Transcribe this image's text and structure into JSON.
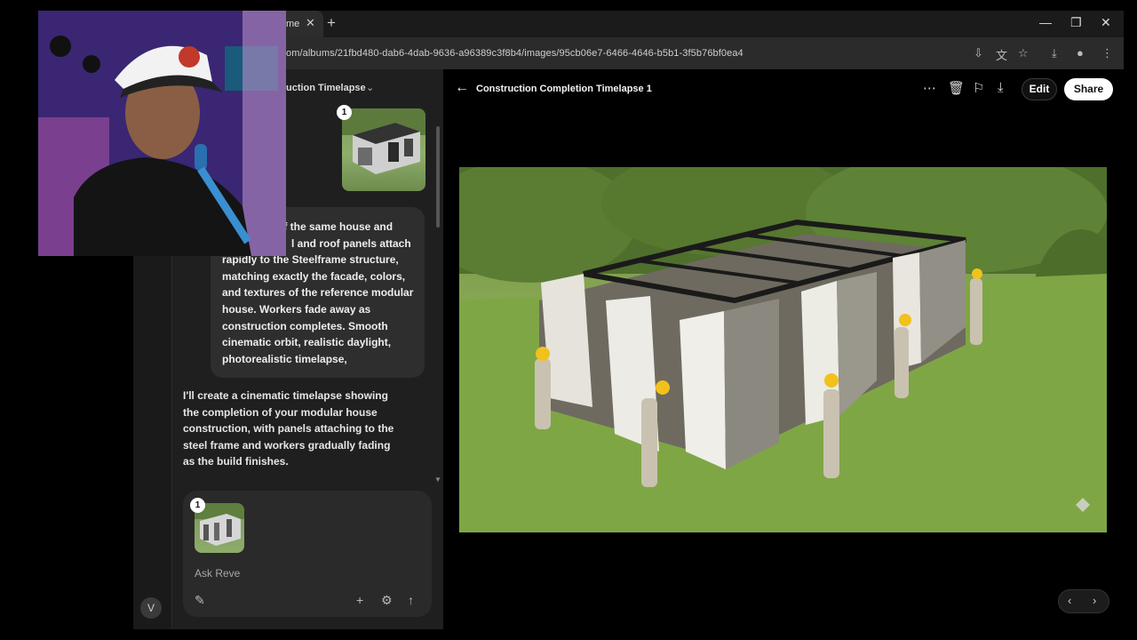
{
  "browser": {
    "tab_title": "me",
    "url": "om/albums/21fbd480-dab6-4dab-9636-a96389c3f8b4/images/95cb06e7-6466-4646-b5b1-3f5b76bf0ea4"
  },
  "chat": {
    "album_title": "uction Timelapse",
    "thumb_badge": "1",
    "user_prompt": "of the same house and l and roof panels attach rapidly to the Steelframe structure, matching exactly the facade, colors, and textures of the reference modular house. Workers fade away as construction completes. Smooth cinematic orbit, realistic daylight, photorealistic timelapse,",
    "user_prompt_lines": [
      "of the same house and",
      "l and roof panels attach",
      "rapidly to the Steelframe structure,",
      "matching exactly the facade, colors,",
      "and textures of the reference modular",
      "house. Workers fade away as",
      "construction completes. Smooth",
      "cinematic orbit, realistic daylight,",
      "photorealistic timelapse,"
    ],
    "assistant_lines": [
      "I'll create a cinematic timelapse showing",
      "the completion of your modular house",
      "construction, with panels attaching to the",
      "steel frame and workers gradually fading",
      "as the build finishes."
    ],
    "composer": {
      "badge": "1",
      "placeholder": "Ask Reve"
    },
    "avatar_initial": "V"
  },
  "viewer": {
    "title": "Construction Completion Timelapse 1",
    "edit_label": "Edit",
    "share_label": "Share"
  },
  "colors": {
    "background": "#000000",
    "panel": "#1f1f1f",
    "bubble": "#2e2e2e",
    "share_button": "#ffffff"
  }
}
